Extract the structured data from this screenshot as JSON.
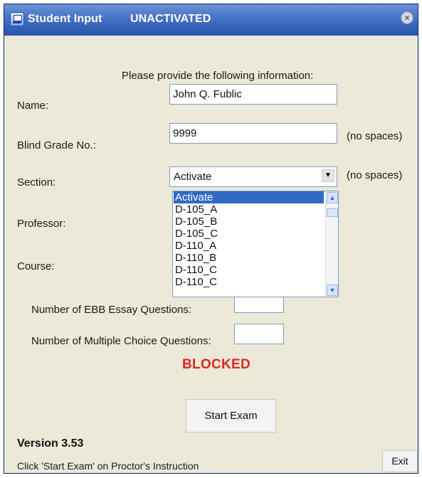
{
  "window": {
    "title": "Student Input",
    "status_title": "UNACTIVATED"
  },
  "form": {
    "prompt": "Please provide the following information:",
    "name_label": "Name:",
    "name_value": "John Q. Fublic",
    "blind_grade_label": "Blind Grade No.:",
    "blind_grade_value": "9999",
    "no_spaces_note_1": "(no spaces)",
    "section_label": "Section:",
    "section_value": "Activate",
    "no_spaces_note_2": "(no spaces)",
    "professor_label": "Professor:",
    "course_label": "Course:",
    "ebb_label": "Number of EBB Essay Questions:",
    "ebb_value": "",
    "mcq_label": "Number of Multiple Choice Questions:",
    "mcq_value": ""
  },
  "dropdown": {
    "options": [
      "Activate",
      "D-105_A",
      "D-105_B",
      "D-105_C",
      "D-110_A",
      "D-110_B",
      "D-110_C",
      "D-110_C"
    ],
    "selected_index": 0
  },
  "status": {
    "blocked": "BLOCKED"
  },
  "buttons": {
    "start_exam": "Start Exam",
    "exit": "Exit"
  },
  "footer": {
    "version": "Version 3.53",
    "instruction": "Click 'Start Exam' on Proctor's Instruction"
  },
  "icons": {
    "window": "window-icon",
    "close": "close-icon",
    "dropdown_arrow": "chevron-down-icon",
    "scroll_up": "chevron-up-icon",
    "scroll_down": "chevron-down-icon"
  },
  "colors": {
    "titlebar": "#2a55a8",
    "dialog": "#ece9d8",
    "selection": "#3169c6",
    "blocked": "#e1251b"
  }
}
